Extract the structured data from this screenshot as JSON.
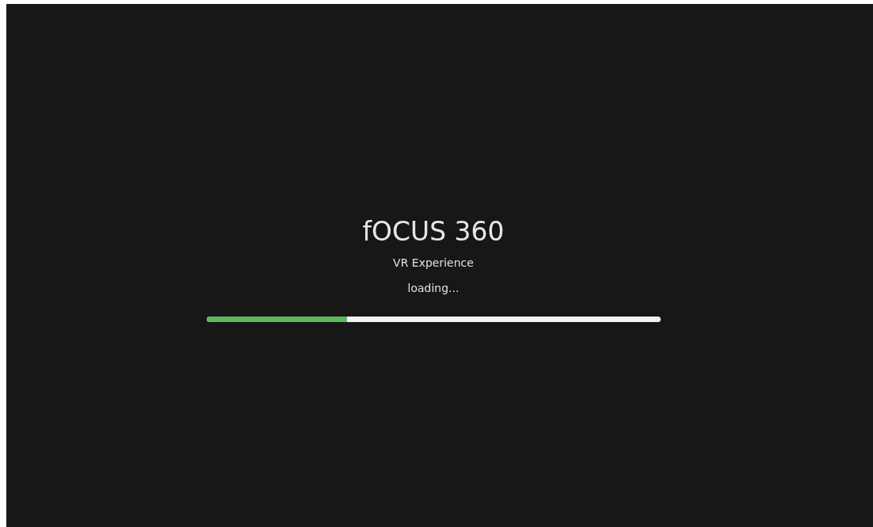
{
  "title": "fOCUS 360",
  "subtitle": "VR Experience",
  "status": "loading...",
  "progress": {
    "level": 0.31
  }
}
